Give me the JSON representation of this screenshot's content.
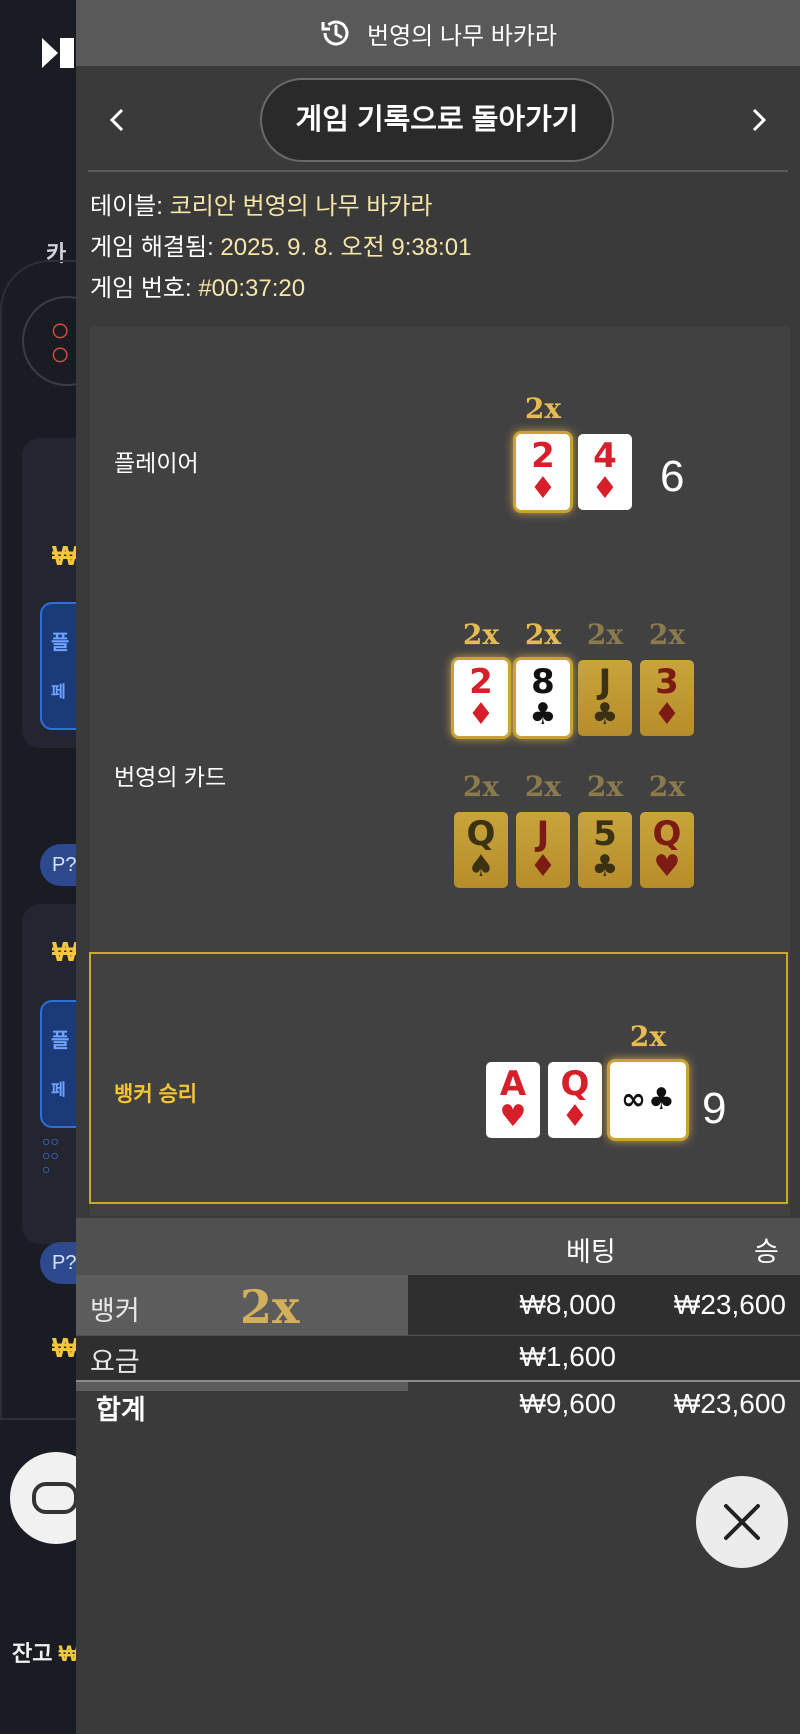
{
  "header": {
    "title": "번영의 나무 바카라",
    "back_label": "게임 기록으로 돌아가기",
    "prev_icon": "chevron-left-icon",
    "next_icon": "chevron-right-icon",
    "history_icon": "history-icon"
  },
  "info": {
    "table_label": "테이블:",
    "table_value": "코리안 번영의 나무 바카라",
    "resolved_label": "게임 해결됨:",
    "resolved_value": "2025. 9. 8. 오전 9:38:01",
    "game_no_label": "게임 번호:",
    "game_no_value": "#00:37:20"
  },
  "player": {
    "label": "플레이어",
    "score": "6",
    "cards": [
      {
        "rank": "2",
        "suit": "♦",
        "color": "red",
        "mult": "2x"
      },
      {
        "rank": "4",
        "suit": "♦",
        "color": "red",
        "mult": ""
      }
    ]
  },
  "prosperity": {
    "label": "번영의 카드",
    "row1": [
      {
        "rank": "2",
        "suit": "♦",
        "color": "red",
        "mult": "2x"
      },
      {
        "rank": "8",
        "suit": "♣",
        "color": "black",
        "mult": "2x"
      },
      {
        "rank": "J",
        "suit": "♣",
        "color": "black",
        "mult": "2x"
      },
      {
        "rank": "3",
        "suit": "♦",
        "color": "red",
        "mult": "2x"
      }
    ],
    "row2": [
      {
        "rank": "Q",
        "suit": "♠",
        "color": "black",
        "mult": "2x"
      },
      {
        "rank": "J",
        "suit": "♦",
        "color": "red",
        "mult": "2x"
      },
      {
        "rank": "5",
        "suit": "♣",
        "color": "black",
        "mult": "2x"
      },
      {
        "rank": "Q",
        "suit": "♥",
        "color": "red",
        "mult": "2x"
      }
    ]
  },
  "banker": {
    "label": "뱅커 승리",
    "score": "9",
    "cards": [
      {
        "rank": "A",
        "suit": "♥",
        "color": "red",
        "mult": ""
      },
      {
        "rank": "Q",
        "suit": "♦",
        "color": "red",
        "mult": ""
      },
      {
        "rank": "∞",
        "suit": "♣",
        "color": "black",
        "mult": "2x"
      }
    ]
  },
  "results": {
    "col_bet": "베팅",
    "col_win": "승",
    "rows": [
      {
        "label": "뱅커",
        "mult": "2x",
        "bet": "₩8,000",
        "win": "₩23,600"
      },
      {
        "label": "요금",
        "bet": "₩1,600",
        "win": ""
      }
    ],
    "total_label": "합계",
    "total_bet": "₩9,600",
    "total_win": "₩23,600"
  },
  "background": {
    "tab_fragment": "카",
    "pbox_label_1": "플",
    "pbox_label_2": "페",
    "pill_label": "P?",
    "balance_label": "잔고",
    "balance_currency": "₩"
  },
  "colors": {
    "accent_gold": "#f2c532",
    "info_value": "#f5e6a8",
    "multiplier_gold": "#e7bb54",
    "red_suit": "#d71f2b"
  }
}
